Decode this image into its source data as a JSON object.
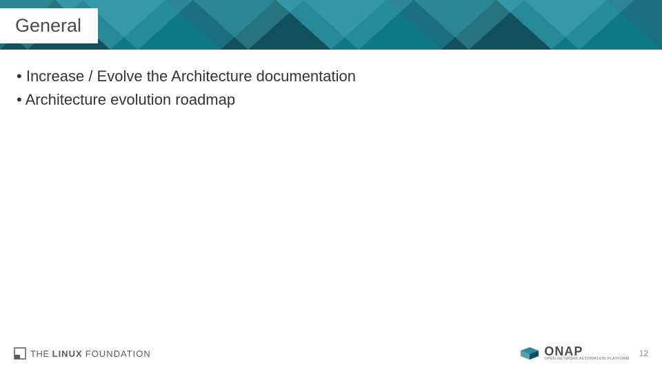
{
  "header": {
    "title": "General"
  },
  "content": {
    "bullets": [
      "Increase / Evolve the Architecture documentation",
      "Architecture evolution roadmap"
    ]
  },
  "footer": {
    "linux_foundation": {
      "the": "THE",
      "linux": "LINUX",
      "foundation": "FOUNDATION"
    },
    "onap": {
      "name": "ONAP",
      "tagline": "OPEN NETWORK AUTOMATION PLATFORM"
    },
    "page_number": "12"
  },
  "colors": {
    "header_base": "#1a6e7d",
    "header_dark": "#124e59",
    "header_mid": "#2a8c9c",
    "header_light": "#4fb3bf",
    "header_teal": "#0d7a8a"
  }
}
